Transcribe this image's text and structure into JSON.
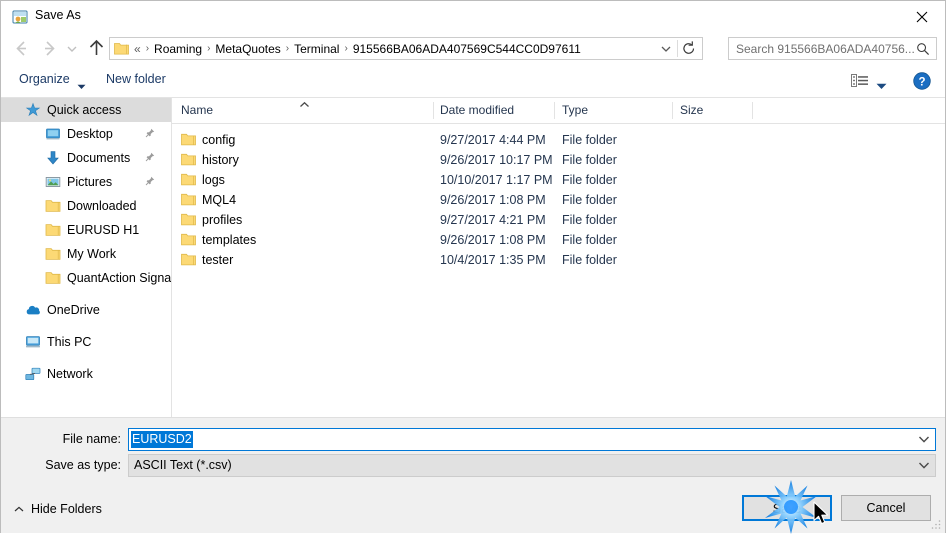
{
  "window": {
    "title": "Save As",
    "title_icon": "save-as-icon",
    "close_icon": "close-icon"
  },
  "navigation": {
    "back_icon": "arrow-left-icon",
    "forward_icon": "arrow-right-icon",
    "recent_icon": "chevron-down-icon",
    "up_icon": "arrow-up-icon",
    "folder_icon": "folder-icon",
    "breadcrumb_prefix": "«",
    "breadcrumbs": [
      "Roaming",
      "MetaQuotes",
      "Terminal",
      "915566BA06ADA407569C544CC0D97611"
    ],
    "breadcrumb_separator": "›",
    "address_chevron_icon": "chevron-down-icon",
    "refresh_icon": "refresh-icon"
  },
  "search": {
    "placeholder": "Search 915566BA06ADA40756...",
    "icon": "search-icon"
  },
  "toolbar": {
    "organize_label": "Organize",
    "organize_caret_icon": "caret-down-icon",
    "new_folder_label": "New folder",
    "view_icon": "view-layout-icon",
    "view_caret_icon": "caret-down-icon",
    "help_icon": "help-icon",
    "help_glyph": "?"
  },
  "sidebar": {
    "items": [
      {
        "label": "Quick access",
        "icon": "star-icon",
        "level": 0,
        "selected": true,
        "pinned": false
      },
      {
        "label": "Desktop",
        "icon": "monitor-icon",
        "level": 1,
        "selected": false,
        "pinned": true
      },
      {
        "label": "Documents",
        "icon": "download-arrow-icon",
        "level": 1,
        "selected": false,
        "pinned": true
      },
      {
        "label": "Pictures",
        "icon": "picture-icon",
        "level": 1,
        "selected": false,
        "pinned": true
      },
      {
        "label": "Downloaded",
        "icon": "folder-icon",
        "level": 1,
        "selected": false,
        "pinned": false
      },
      {
        "label": "EURUSD H1",
        "icon": "folder-icon",
        "level": 1,
        "selected": false,
        "pinned": false
      },
      {
        "label": "My Work",
        "icon": "folder-icon",
        "level": 1,
        "selected": false,
        "pinned": false
      },
      {
        "label": "QuantAction Signal",
        "icon": "folder-icon",
        "level": 1,
        "selected": false,
        "pinned": false
      },
      {
        "label": "OneDrive",
        "icon": "cloud-icon",
        "level": 0,
        "selected": false,
        "pinned": false,
        "gap_before": true
      },
      {
        "label": "This PC",
        "icon": "computer-icon",
        "level": 0,
        "selected": false,
        "pinned": false,
        "gap_before": true
      },
      {
        "label": "Network",
        "icon": "network-icon",
        "level": 0,
        "selected": false,
        "pinned": false,
        "gap_before": true
      }
    ]
  },
  "filelist": {
    "columns": [
      "Name",
      "Date modified",
      "Type",
      "Size"
    ],
    "sort_column": "Name",
    "sort_direction": "ascending",
    "sort_icon": "chevron-up-icon",
    "rows": [
      {
        "name": "config",
        "date": "9/27/2017 4:44 PM",
        "type": "File folder",
        "size": "",
        "icon": "folder-icon"
      },
      {
        "name": "history",
        "date": "9/26/2017 10:17 PM",
        "type": "File folder",
        "size": "",
        "icon": "folder-icon"
      },
      {
        "name": "logs",
        "date": "10/10/2017 1:17 PM",
        "type": "File folder",
        "size": "",
        "icon": "folder-icon"
      },
      {
        "name": "MQL4",
        "date": "9/26/2017 1:08 PM",
        "type": "File folder",
        "size": "",
        "icon": "folder-icon"
      },
      {
        "name": "profiles",
        "date": "9/27/2017 4:21 PM",
        "type": "File folder",
        "size": "",
        "icon": "folder-icon"
      },
      {
        "name": "templates",
        "date": "9/26/2017 1:08 PM",
        "type": "File folder",
        "size": "",
        "icon": "folder-icon"
      },
      {
        "name": "tester",
        "date": "10/4/2017 1:35 PM",
        "type": "File folder",
        "size": "",
        "icon": "folder-icon"
      }
    ]
  },
  "form": {
    "filename_label": "File name:",
    "filename_value": "EURUSD2",
    "filename_selected": true,
    "filetype_label": "Save as type:",
    "filetype_value": "ASCII Text (*.csv)",
    "chevron_icon": "chevron-down-icon"
  },
  "footer": {
    "hide_folders_label": "Hide Folders",
    "hide_folders_caret_icon": "caret-up-icon",
    "save_label": "Save",
    "cancel_label": "Cancel",
    "resize_grip_icon": "resize-grip-icon"
  },
  "pointer": {
    "cursor_icon": "mouse-cursor-icon",
    "click_effect_icon": "click-burst-icon",
    "click_target": "Save"
  },
  "colors": {
    "accent": "#0078d7",
    "selection": "#0078d7",
    "sidebar_selected": "#dcdcdc",
    "chrome": "#f0f0f0",
    "folder": "#fcd975"
  }
}
